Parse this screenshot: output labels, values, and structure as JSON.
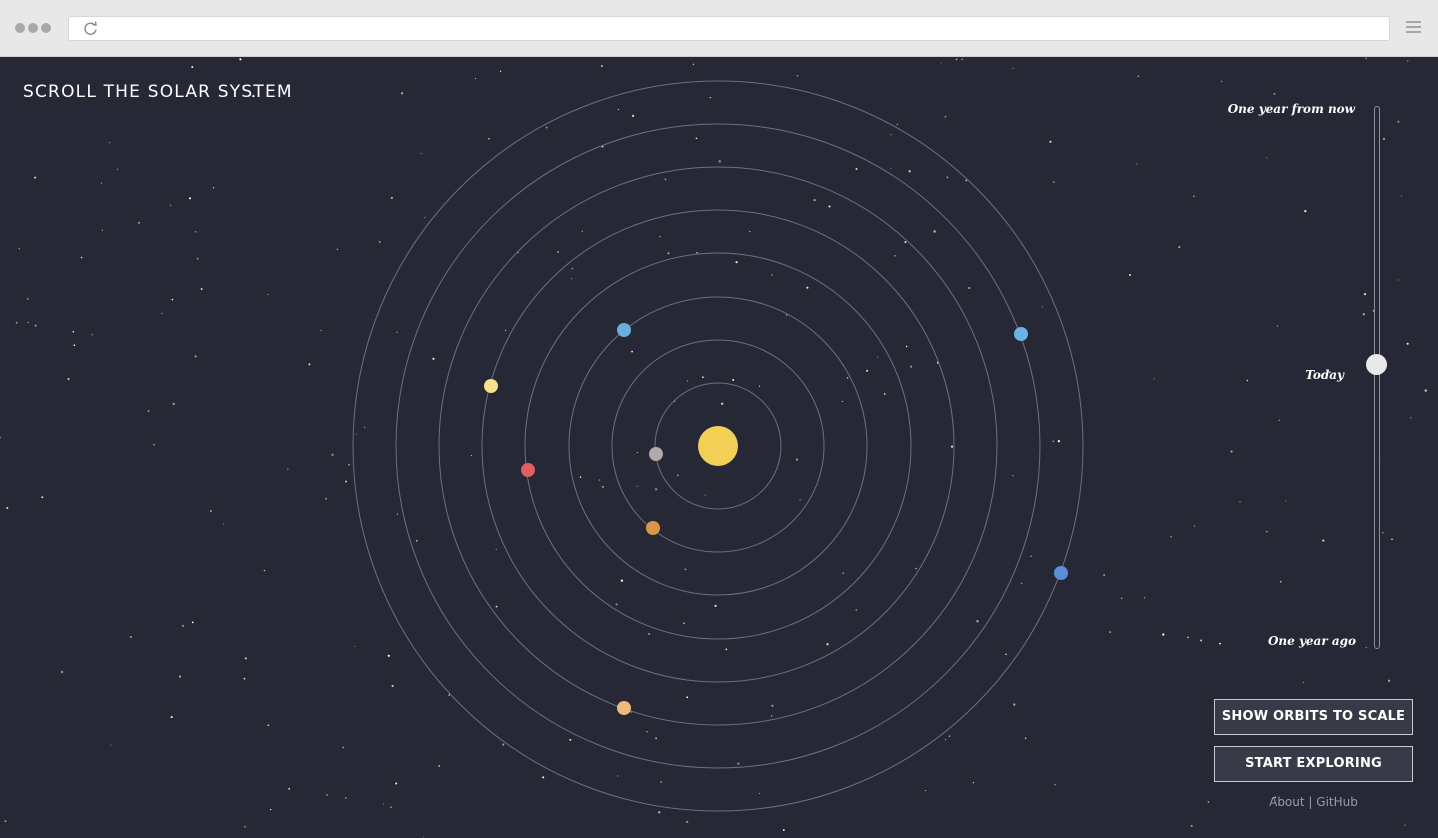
{
  "browser": {
    "reload_icon": "reload-icon",
    "menu_icon": "hamburger-menu-icon"
  },
  "page": {
    "title": "SCROLL THE SOLAR SYSTEM"
  },
  "time_slider": {
    "top_label": "One year from now",
    "current_label": "Today",
    "bottom_label": "One year ago",
    "position_fraction": 0.5
  },
  "buttons": {
    "show_orbits_to_scale": "SHOW ORBITS TO SCALE",
    "start_exploring": "START EXPLORING"
  },
  "footer": {
    "about": "About",
    "separator": "|",
    "github": "GitHub"
  },
  "colors": {
    "background": "#272836",
    "sun": "#f2cf55",
    "orbit": "#6e6f80",
    "mercury": "#b1aaa6",
    "venus": "#dc9448",
    "earth": "#6aaedf",
    "mars": "#de6160",
    "jupiter": "#f6e18c",
    "saturn": "#efbb7a",
    "uranus": "#6ab3e6",
    "neptune": "#5c8ed8"
  }
}
